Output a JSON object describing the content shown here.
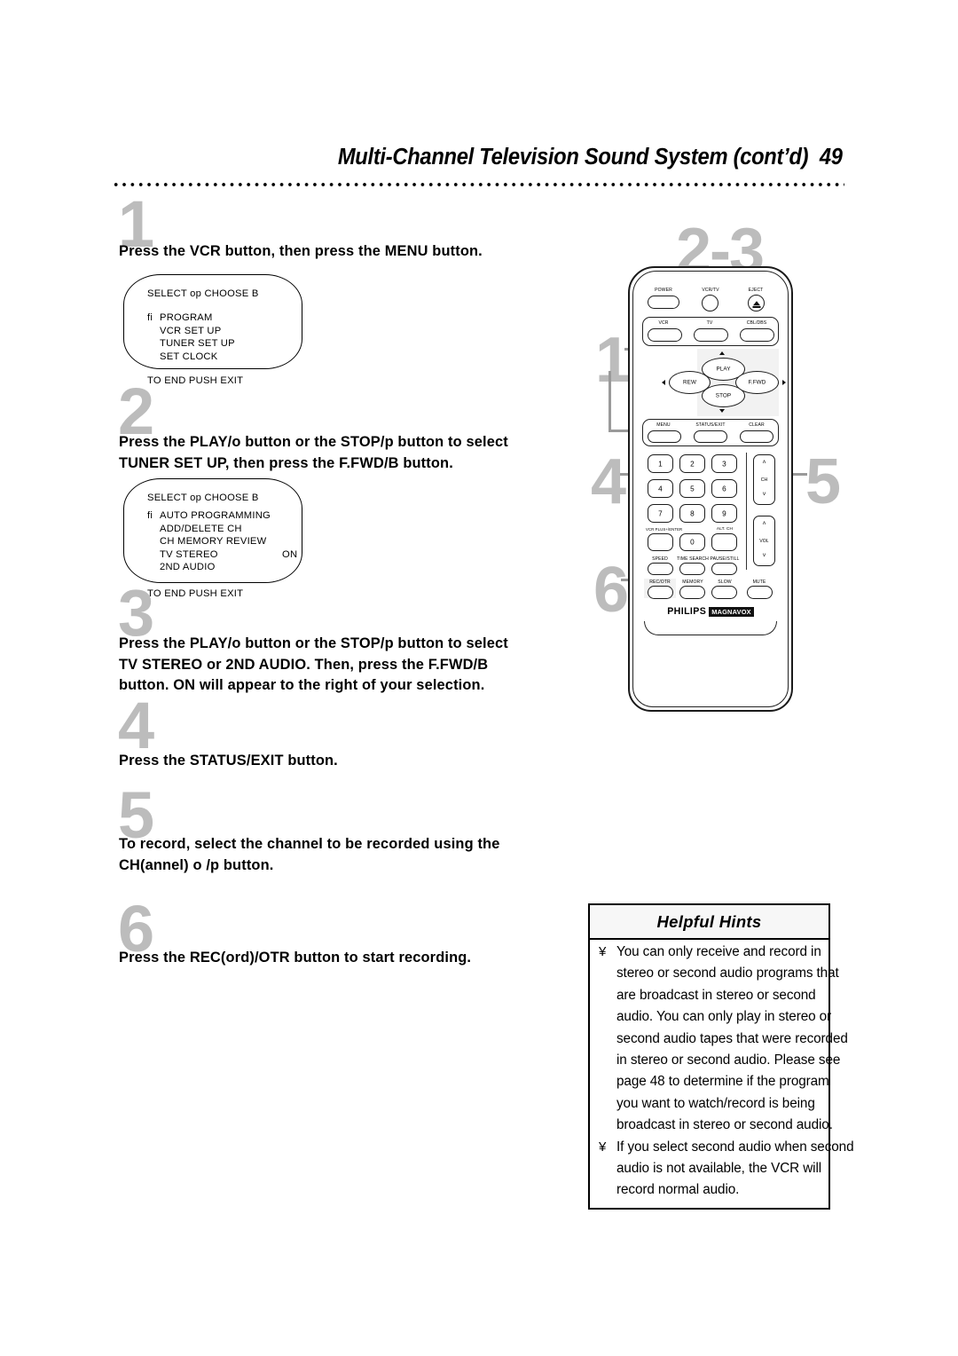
{
  "header": {
    "title": "Multi-Channel Television Sound System (cont’d)",
    "page_number": "49"
  },
  "steps": [
    {
      "num": "1",
      "text": "Press the VCR button, then press the MENU button."
    },
    {
      "num": "2",
      "text_line1": "Press the PLAY/o  button or the STOP/p  button to select",
      "text_line2": "TUNER SET UP, then press the F.FWD/B  button."
    },
    {
      "num": "3",
      "text_line1": "Press the PLAY/o  button or the STOP/p  button to select",
      "text_line2": "TV STEREO or 2ND AUDIO.  Then, press the F.FWD/B",
      "text_line3": "button. ON will appear to the right of your selection."
    },
    {
      "num": "4",
      "text": "Press the STATUS/EXIT button."
    },
    {
      "num": "5",
      "text_line1": "To record, select the channel to be recorded using the",
      "text_line2": "CH(annel) o /p button."
    },
    {
      "num": "6",
      "text": "Press the REC(ord)/OTR button to start recording."
    }
  ],
  "osd_menu_1": {
    "header": "SELECT op   CHOOSE B",
    "items": [
      {
        "indicator": "fi",
        "label": "PROGRAM",
        "value": ""
      },
      {
        "indicator": "",
        "label": "VCR SET UP",
        "value": ""
      },
      {
        "indicator": "",
        "label": "TUNER SET UP",
        "value": ""
      },
      {
        "indicator": "",
        "label": "SET CLOCK",
        "value": ""
      }
    ],
    "footer": "TO END PUSH EXIT"
  },
  "osd_menu_2": {
    "header": "SELECT op   CHOOSE B",
    "items": [
      {
        "indicator": "fi",
        "label": "AUTO PROGRAMMING",
        "value": ""
      },
      {
        "indicator": "",
        "label": "ADD/DELETE CH",
        "value": ""
      },
      {
        "indicator": "",
        "label": "CH MEMORY REVIEW",
        "value": ""
      },
      {
        "indicator": "",
        "label": "TV STEREO",
        "value": "ON"
      },
      {
        "indicator": "",
        "label": "2ND AUDIO",
        "value": ""
      }
    ],
    "footer": "TO END PUSH EXIT"
  },
  "callouts": [
    {
      "id": "1",
      "label": "1",
      "target": "VCR and MENU buttons"
    },
    {
      "id": "2-3",
      "label": "2-3",
      "target": "PLAY / STOP / F.FWD cluster"
    },
    {
      "id": "4",
      "label": "4",
      "target": "STATUS/EXIT button"
    },
    {
      "id": "5",
      "label": "5",
      "target": "CH up/down rocker"
    },
    {
      "id": "6",
      "label": "6",
      "target": "REC/OTR button"
    }
  ],
  "remote": {
    "brand": "PHILIPS",
    "sub_brand": "MAGNAVOX",
    "top_row": [
      "POWER",
      "VCR/TV",
      "EJECT"
    ],
    "device_row": [
      "VCR",
      "TV",
      "CBL/DBS"
    ],
    "transport": {
      "play": "PLAY",
      "stop": "STOP",
      "rew": "REW",
      "ffwd": "F.FWD"
    },
    "menu_row": [
      "MENU",
      "STATUS/EXIT",
      "CLEAR"
    ],
    "keypad": [
      "1",
      "2",
      "3",
      "4",
      "5",
      "6",
      "7",
      "8",
      "9"
    ],
    "keypad_bottom": {
      "vcr_plus": "VCR PLUS+/ENTER",
      "zero": "0",
      "alt_ch": "ALT. CH"
    },
    "func_row": [
      "SPEED",
      "TIME SEARCH",
      "PAUSE/STILL"
    ],
    "bottom_row": [
      "REC/OTR",
      "MEMORY",
      "SLOW",
      "MUTE"
    ],
    "rockers": [
      {
        "label": "CH",
        "up": "˄",
        "down": "˅"
      },
      {
        "label": "VOL",
        "up": "˄",
        "down": "˅"
      }
    ]
  },
  "hints": {
    "title": "Helpful Hints",
    "items": [
      "You can only receive and record in stereo or second audio programs that are broadcast in stereo or second audio.  You can only play in stereo or second audio tapes that were recorded in stereo or second audio.  Please see page 48 to determine if the program you want to watch/record is being broadcast in stereo or second audio.",
      "If you select second audio when second audio is not available, the VCR will record normal audio."
    ],
    "bullet": "¥"
  }
}
